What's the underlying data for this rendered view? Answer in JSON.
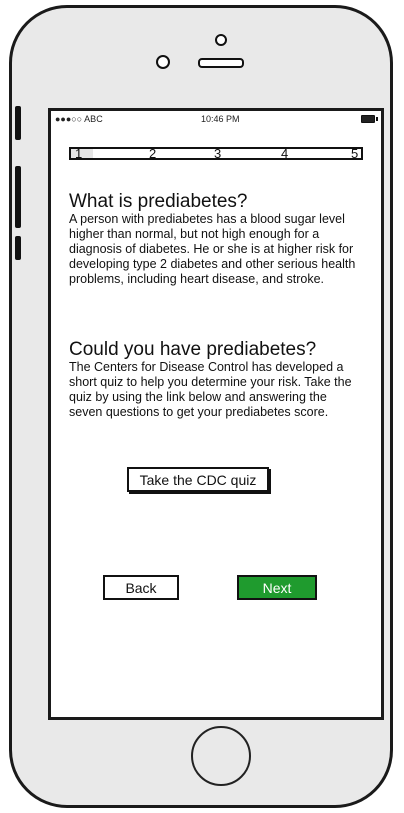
{
  "status_bar": {
    "carrier": "●●●○○ ABC",
    "time": "10:46 PM",
    "battery_icon": "battery-icon"
  },
  "steps": [
    "1",
    "2",
    "3",
    "4",
    "5"
  ],
  "current_step": 1,
  "section1": {
    "title": "What is prediabetes?",
    "body": "A person with prediabetes has a blood sugar level higher than normal, but not high enough for a diagnosis of diabetes. He or she is at higher risk for developing type 2 diabetes and other serious health problems, including heart disease, and stroke."
  },
  "section2": {
    "title": "Could you have prediabetes?",
    "body": "The Centers for Disease Control has developed a  short quiz to help you determine your risk. Take the quiz by using the link below and answering the seven questions to get your prediabetes score."
  },
  "buttons": {
    "quiz": "Take the CDC quiz",
    "back": "Back",
    "next": "Next"
  },
  "colors": {
    "next_button": "#1f9b2e"
  }
}
